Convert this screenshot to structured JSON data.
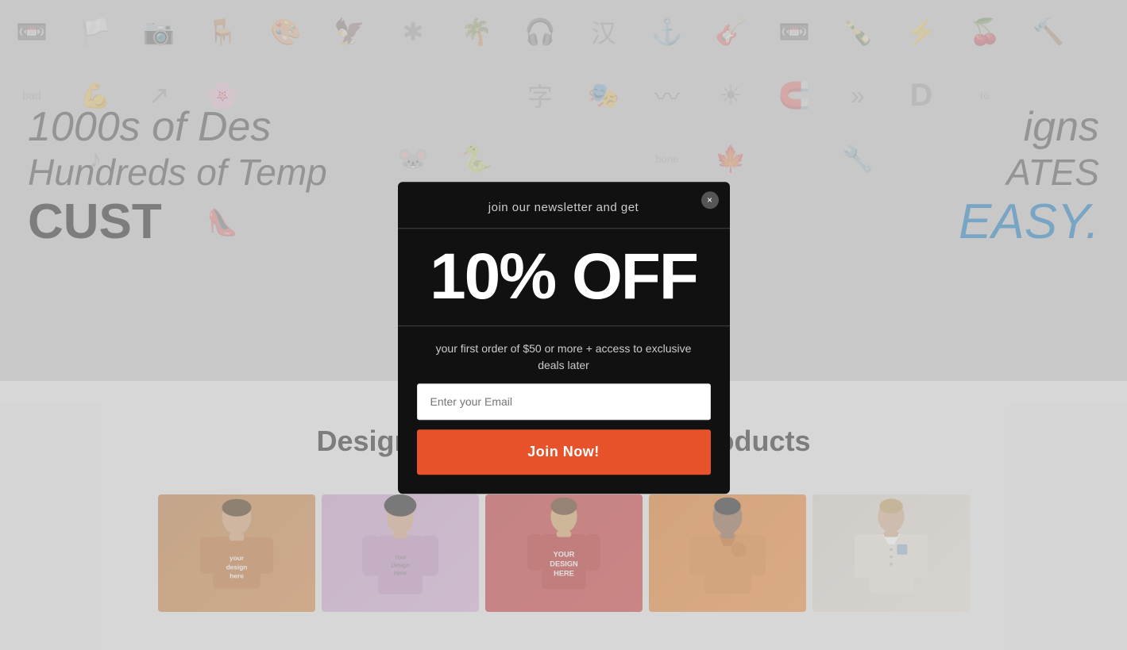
{
  "hero": {
    "line1": "1000s of Des",
    "line2": "Hundreds of Temp",
    "line3": "CUST",
    "right_line1": "igns",
    "right_line2": "ATES",
    "easy_text": "EASY.",
    "period": "."
  },
  "modal": {
    "subtitle": "join our newsletter and get",
    "discount": "10% OFF",
    "description": "your first order of $50 or more + access to exclusive deals later",
    "email_placeholder": "Enter your Email",
    "join_button_label": "Join Now!",
    "close_label": "×"
  },
  "bottom": {
    "section_title": "Design Your Own: Our Top Products",
    "products": [
      {
        "id": 1,
        "color": "orange-brown"
      },
      {
        "id": 2,
        "color": "lavender"
      },
      {
        "id": 3,
        "color": "red"
      },
      {
        "id": 4,
        "color": "orange"
      },
      {
        "id": 5,
        "color": "white-gray"
      }
    ]
  },
  "colors": {
    "accent_teal": "#2bc4b4",
    "accent_blue": "#1a7bbf",
    "button_orange": "#e8522a",
    "modal_bg": "#111111"
  }
}
